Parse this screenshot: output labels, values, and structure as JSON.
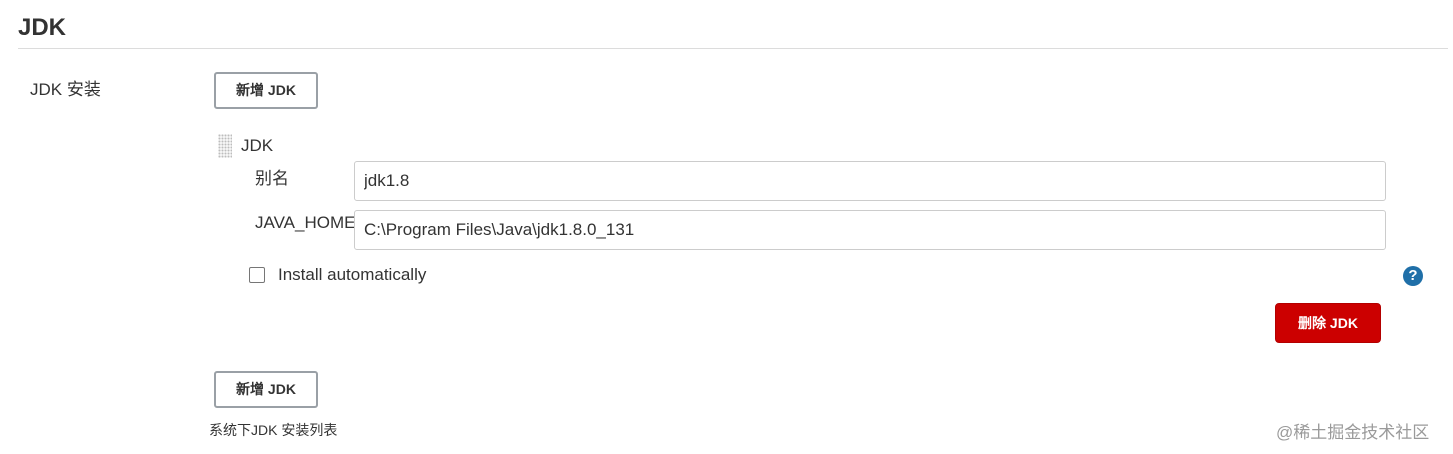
{
  "section": {
    "title": "JDK"
  },
  "field": {
    "label": "JDK 安装",
    "description": "系统下JDK 安装列表"
  },
  "buttons": {
    "add_top": "新增 JDK",
    "add_bottom": "新增 JDK",
    "delete": "删除 JDK"
  },
  "installation": {
    "title": "JDK",
    "alias": {
      "label": "别名",
      "value": "jdk1.8"
    },
    "java_home": {
      "label": "JAVA_HOME",
      "value": "C:\\Program Files\\Java\\jdk1.8.0_131"
    },
    "install_automatically": {
      "label": "Install automatically",
      "checked": false
    }
  },
  "help": {
    "icon": "?"
  },
  "watermark": "@稀土掘金技术社区",
  "colors": {
    "delete_button": "#cc0000",
    "help_icon": "#1f6fa8"
  }
}
